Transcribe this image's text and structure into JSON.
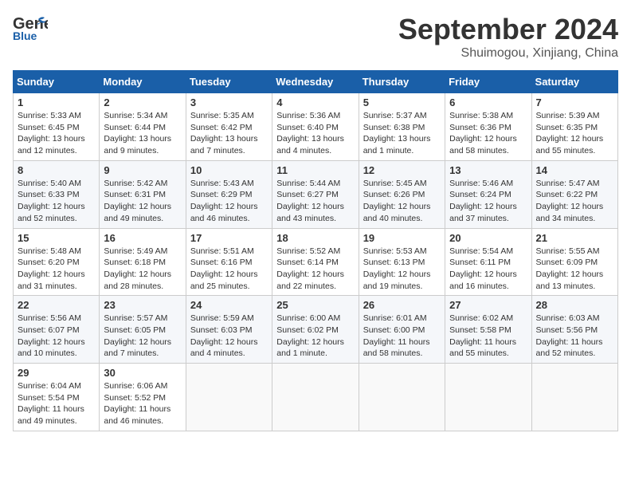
{
  "header": {
    "logo_line1": "General",
    "logo_line2": "Blue",
    "month_year": "September 2024",
    "location": "Shuimogou, Xinjiang, China"
  },
  "days_of_week": [
    "Sunday",
    "Monday",
    "Tuesday",
    "Wednesday",
    "Thursday",
    "Friday",
    "Saturday"
  ],
  "weeks": [
    [
      {
        "day": "1",
        "sunrise": "5:33 AM",
        "sunset": "6:45 PM",
        "daylight": "13 hours and 12 minutes."
      },
      {
        "day": "2",
        "sunrise": "5:34 AM",
        "sunset": "6:44 PM",
        "daylight": "13 hours and 9 minutes."
      },
      {
        "day": "3",
        "sunrise": "5:35 AM",
        "sunset": "6:42 PM",
        "daylight": "13 hours and 7 minutes."
      },
      {
        "day": "4",
        "sunrise": "5:36 AM",
        "sunset": "6:40 PM",
        "daylight": "13 hours and 4 minutes."
      },
      {
        "day": "5",
        "sunrise": "5:37 AM",
        "sunset": "6:38 PM",
        "daylight": "13 hours and 1 minute."
      },
      {
        "day": "6",
        "sunrise": "5:38 AM",
        "sunset": "6:36 PM",
        "daylight": "12 hours and 58 minutes."
      },
      {
        "day": "7",
        "sunrise": "5:39 AM",
        "sunset": "6:35 PM",
        "daylight": "12 hours and 55 minutes."
      }
    ],
    [
      {
        "day": "8",
        "sunrise": "5:40 AM",
        "sunset": "6:33 PM",
        "daylight": "12 hours and 52 minutes."
      },
      {
        "day": "9",
        "sunrise": "5:42 AM",
        "sunset": "6:31 PM",
        "daylight": "12 hours and 49 minutes."
      },
      {
        "day": "10",
        "sunrise": "5:43 AM",
        "sunset": "6:29 PM",
        "daylight": "12 hours and 46 minutes."
      },
      {
        "day": "11",
        "sunrise": "5:44 AM",
        "sunset": "6:27 PM",
        "daylight": "12 hours and 43 minutes."
      },
      {
        "day": "12",
        "sunrise": "5:45 AM",
        "sunset": "6:26 PM",
        "daylight": "12 hours and 40 minutes."
      },
      {
        "day": "13",
        "sunrise": "5:46 AM",
        "sunset": "6:24 PM",
        "daylight": "12 hours and 37 minutes."
      },
      {
        "day": "14",
        "sunrise": "5:47 AM",
        "sunset": "6:22 PM",
        "daylight": "12 hours and 34 minutes."
      }
    ],
    [
      {
        "day": "15",
        "sunrise": "5:48 AM",
        "sunset": "6:20 PM",
        "daylight": "12 hours and 31 minutes."
      },
      {
        "day": "16",
        "sunrise": "5:49 AM",
        "sunset": "6:18 PM",
        "daylight": "12 hours and 28 minutes."
      },
      {
        "day": "17",
        "sunrise": "5:51 AM",
        "sunset": "6:16 PM",
        "daylight": "12 hours and 25 minutes."
      },
      {
        "day": "18",
        "sunrise": "5:52 AM",
        "sunset": "6:14 PM",
        "daylight": "12 hours and 22 minutes."
      },
      {
        "day": "19",
        "sunrise": "5:53 AM",
        "sunset": "6:13 PM",
        "daylight": "12 hours and 19 minutes."
      },
      {
        "day": "20",
        "sunrise": "5:54 AM",
        "sunset": "6:11 PM",
        "daylight": "12 hours and 16 minutes."
      },
      {
        "day": "21",
        "sunrise": "5:55 AM",
        "sunset": "6:09 PM",
        "daylight": "12 hours and 13 minutes."
      }
    ],
    [
      {
        "day": "22",
        "sunrise": "5:56 AM",
        "sunset": "6:07 PM",
        "daylight": "12 hours and 10 minutes."
      },
      {
        "day": "23",
        "sunrise": "5:57 AM",
        "sunset": "6:05 PM",
        "daylight": "12 hours and 7 minutes."
      },
      {
        "day": "24",
        "sunrise": "5:59 AM",
        "sunset": "6:03 PM",
        "daylight": "12 hours and 4 minutes."
      },
      {
        "day": "25",
        "sunrise": "6:00 AM",
        "sunset": "6:02 PM",
        "daylight": "12 hours and 1 minute."
      },
      {
        "day": "26",
        "sunrise": "6:01 AM",
        "sunset": "6:00 PM",
        "daylight": "11 hours and 58 minutes."
      },
      {
        "day": "27",
        "sunrise": "6:02 AM",
        "sunset": "5:58 PM",
        "daylight": "11 hours and 55 minutes."
      },
      {
        "day": "28",
        "sunrise": "6:03 AM",
        "sunset": "5:56 PM",
        "daylight": "11 hours and 52 minutes."
      }
    ],
    [
      {
        "day": "29",
        "sunrise": "6:04 AM",
        "sunset": "5:54 PM",
        "daylight": "11 hours and 49 minutes."
      },
      {
        "day": "30",
        "sunrise": "6:06 AM",
        "sunset": "5:52 PM",
        "daylight": "11 hours and 46 minutes."
      },
      null,
      null,
      null,
      null,
      null
    ]
  ]
}
